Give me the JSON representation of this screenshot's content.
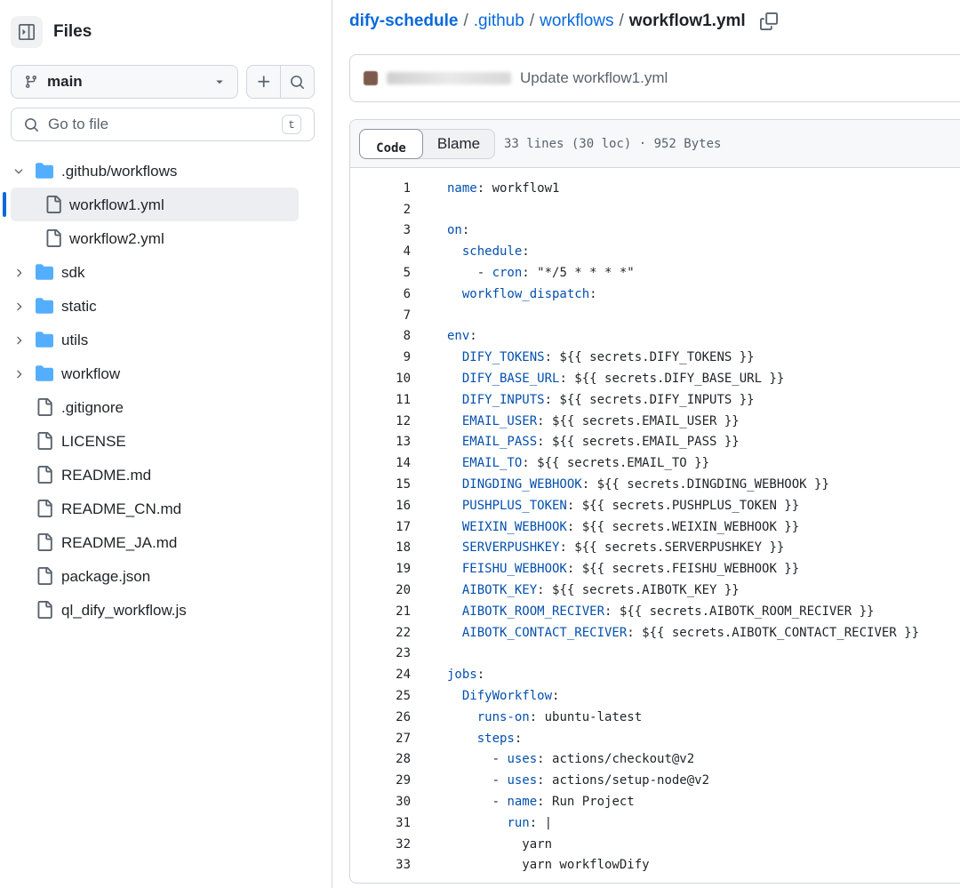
{
  "sidebar": {
    "title": "Files",
    "branch": "main",
    "goto_placeholder": "Go to file",
    "goto_shortcut": "t",
    "tree": [
      {
        "name": ".github/workflows",
        "type": "folder",
        "expanded": true,
        "indent": 0
      },
      {
        "name": "workflow1.yml",
        "type": "file",
        "indent": 1,
        "selected": true
      },
      {
        "name": "workflow2.yml",
        "type": "file",
        "indent": 1
      },
      {
        "name": "sdk",
        "type": "folder",
        "expanded": false,
        "indent": 0
      },
      {
        "name": "static",
        "type": "folder",
        "expanded": false,
        "indent": 0
      },
      {
        "name": "utils",
        "type": "folder",
        "expanded": false,
        "indent": 0
      },
      {
        "name": "workflow",
        "type": "folder",
        "expanded": false,
        "indent": 0
      },
      {
        "name": ".gitignore",
        "type": "file",
        "indent": 0
      },
      {
        "name": "LICENSE",
        "type": "file",
        "indent": 0
      },
      {
        "name": "README.md",
        "type": "file",
        "indent": 0
      },
      {
        "name": "README_CN.md",
        "type": "file",
        "indent": 0
      },
      {
        "name": "README_JA.md",
        "type": "file",
        "indent": 0
      },
      {
        "name": "package.json",
        "type": "file",
        "indent": 0
      },
      {
        "name": "ql_dify_workflow.js",
        "type": "file",
        "indent": 0
      }
    ]
  },
  "breadcrumb": {
    "repo": "dify-schedule",
    "parts": [
      ".github",
      "workflows"
    ],
    "current": "workflow1.yml"
  },
  "commit": {
    "message": "Update workflow1.yml"
  },
  "file": {
    "tabs": [
      "Code",
      "Blame"
    ],
    "active_tab": "Code",
    "meta": "33 lines (30 loc) · 952 Bytes",
    "lines": [
      "name: workflow1",
      "",
      "on:",
      "  schedule:",
      "    - cron: \"*/5 * * * *\"",
      "  workflow_dispatch:",
      "",
      "env:",
      "  DIFY_TOKENS: ${{ secrets.DIFY_TOKENS }}",
      "  DIFY_BASE_URL: ${{ secrets.DIFY_BASE_URL }}",
      "  DIFY_INPUTS: ${{ secrets.DIFY_INPUTS }}",
      "  EMAIL_USER: ${{ secrets.EMAIL_USER }}",
      "  EMAIL_PASS: ${{ secrets.EMAIL_PASS }}",
      "  EMAIL_TO: ${{ secrets.EMAIL_TO }}",
      "  DINGDING_WEBHOOK: ${{ secrets.DINGDING_WEBHOOK }}",
      "  PUSHPLUS_TOKEN: ${{ secrets.PUSHPLUS_TOKEN }}",
      "  WEIXIN_WEBHOOK: ${{ secrets.WEIXIN_WEBHOOK }}",
      "  SERVERPUSHKEY: ${{ secrets.SERVERPUSHKEY }}",
      "  FEISHU_WEBHOOK: ${{ secrets.FEISHU_WEBHOOK }}",
      "  AIBOTK_KEY: ${{ secrets.AIBOTK_KEY }}",
      "  AIBOTK_ROOM_RECIVER: ${{ secrets.AIBOTK_ROOM_RECIVER }}",
      "  AIBOTK_CONTACT_RECIVER: ${{ secrets.AIBOTK_CONTACT_RECIVER }}",
      "",
      "jobs:",
      "  DifyWorkflow:",
      "    runs-on: ubuntu-latest",
      "    steps:",
      "      - uses: actions/checkout@v2",
      "      - uses: actions/setup-node@v2",
      "      - name: Run Project",
      "        run: |",
      "          yarn",
      "          yarn workflowDify"
    ]
  },
  "colors": {
    "link": "#0969da",
    "key": "#0550ae",
    "folder": "#54aeff",
    "selected_bar": "#0969da"
  }
}
